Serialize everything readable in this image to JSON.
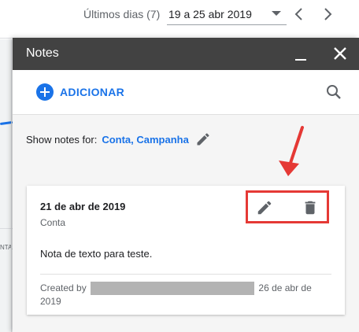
{
  "header": {
    "date_label": "Últimos dias (7)",
    "date_range": "19 a 25 abr 2019",
    "prev_icon": "chevron-left-icon",
    "next_icon": "chevron-right-icon"
  },
  "background": {
    "strip_glyph": "NTAI"
  },
  "panel": {
    "title": "Notes",
    "add_label": "ADICIONAR",
    "filter_label": "Show notes for:",
    "filter_value": "Conta, Campanha"
  },
  "note": {
    "date": "21 de abr de 2019",
    "scope": "Conta",
    "text": "Nota de texto para teste.",
    "created_prefix": "Created by",
    "created_date": "26 de abr de 2019"
  },
  "colors": {
    "accent": "#1a73e8",
    "header_bg": "#424242",
    "highlight": "#e53935"
  }
}
